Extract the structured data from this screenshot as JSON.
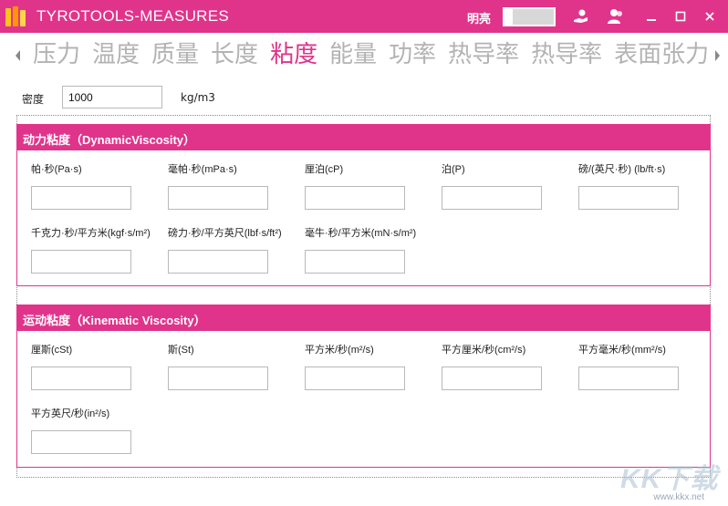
{
  "window": {
    "title": "TYROTOOLS-MEASURES",
    "theme_label": "明亮",
    "colors": {
      "accent": "#e0348b",
      "inactive_text": "#b3b3b3"
    }
  },
  "icons": {
    "app": "bar-chart-icon",
    "share": "hand-share-icon",
    "user": "user-icon",
    "minimize": "minimize-icon",
    "maximize": "maximize-icon",
    "close": "close-icon",
    "nav_prev": "arrow-left-icon",
    "nav_next": "arrow-right-icon"
  },
  "categories": [
    "压力",
    "温度",
    "质量",
    "长度",
    "粘度",
    "能量",
    "功率",
    "热导率",
    "热导率",
    "表面张力"
  ],
  "active_category": "粘度",
  "density": {
    "label": "密度",
    "value": "1000",
    "unit": "kg/m3"
  },
  "dynamic": {
    "title": "动力粘度（DynamicViscosity）",
    "fields": [
      {
        "label": "帕·秒(Pa·s)",
        "value": ""
      },
      {
        "label": "毫帕·秒(mPa·s)",
        "value": ""
      },
      {
        "label": "厘泊(cP)",
        "value": ""
      },
      {
        "label": "泊(P)",
        "value": ""
      },
      {
        "label": "磅/(英尺·秒) (lb/ft·s)",
        "value": ""
      },
      {
        "label": "千克力·秒/平方米(kgf·s/m²)",
        "value": ""
      },
      {
        "label": "磅力·秒/平方英尺(lbf·s/ft²)",
        "value": ""
      },
      {
        "label": "毫牛·秒/平方米(mN·s/m²)",
        "value": ""
      }
    ]
  },
  "kinematic": {
    "title": "运动粘度（Kinematic Viscosity）",
    "fields": [
      {
        "label": "厘斯(cSt)",
        "value": ""
      },
      {
        "label": "斯(St)",
        "value": ""
      },
      {
        "label": "平方米/秒(m²/s)",
        "value": ""
      },
      {
        "label": "平方厘米/秒(cm²/s)",
        "value": ""
      },
      {
        "label": "平方毫米/秒(mm²/s)",
        "value": ""
      },
      {
        "label": "平方英尺/秒(in²/s)",
        "value": ""
      }
    ]
  },
  "watermark": {
    "logo": "KK下载",
    "url": "www.kkx.net"
  }
}
